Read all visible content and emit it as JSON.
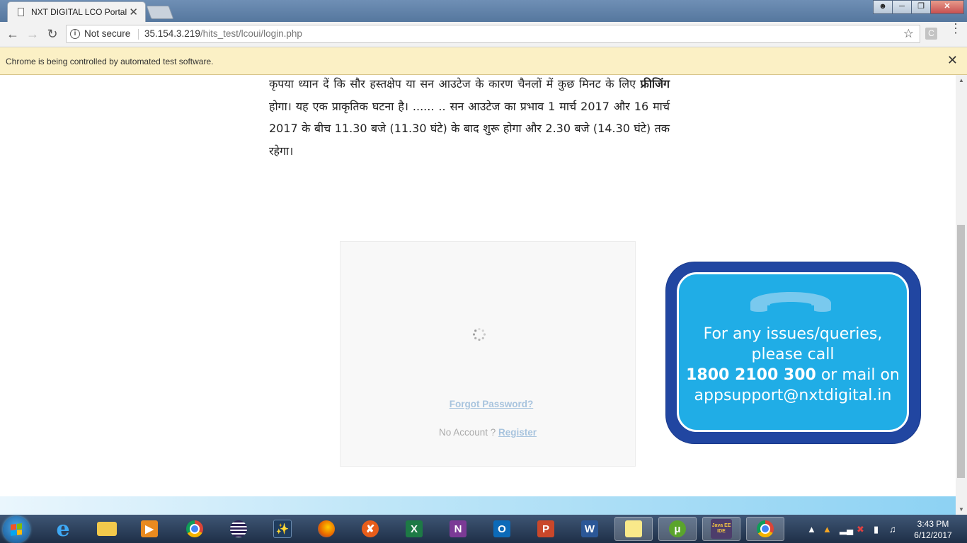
{
  "browser": {
    "tab_title": "NXT DIGITAL LCO Portal",
    "tab_close": "✕",
    "security_label": "Not secure",
    "url_host": "35.154.3.219",
    "url_path": "/hits_test/lcoui/login.php",
    "extension_letter": "C",
    "infobar_text": "Chrome is being controlled by automated test software.",
    "infobar_close": "✕"
  },
  "notice": {
    "text_before_bold": "कृपया ध्यान दें कि सौर हस्तक्षेप या सन आउटेज के कारण चैनलों में कुछ मिनट के लिए ",
    "bold": "फ्रीजिंग",
    "text_after_bold": "  होगा। यह एक प्राकृतिक घटना है। ...... .. सन आउटेज का प्रभाव 1 मार्च 2017 और 16 मार्च 2017 के बीच 11.30 बजे (11.30 घंटे) के बाद शुरू होगा और 2.30 बजे (14.30 घंटे) तक रहेगा।"
  },
  "login": {
    "forgot_password": "Forgot Password?",
    "no_account": "No Account ? ",
    "register": "Register"
  },
  "support_banner": {
    "line1": "For any issues/queries,",
    "line2": "please call",
    "phone": "1800 2100 300",
    "line3_suffix": " or mail on",
    "email": "appsupport@nxtdigital.in"
  },
  "taskbar": {
    "icons": [
      "start-button",
      "internet-explorer",
      "file-explorer",
      "media-player",
      "chrome",
      "eclipse",
      "mysql-workbench",
      "firefox",
      "tool",
      "excel",
      "onenote",
      "outlook",
      "powerpoint",
      "word",
      "sticky-notes",
      "utorrent",
      "java-ee-ide",
      "chrome-active"
    ],
    "labels": {
      "excel": "X",
      "onenote": "N",
      "outlook": "O",
      "powerpoint": "P",
      "word": "W",
      "java_ee": "Java EE IDE"
    },
    "time": "3:43 PM",
    "date": "6/12/2017"
  },
  "colors": {
    "infobar_bg": "#fbf0c5",
    "link_color": "#a8c4de",
    "banner_outer": "#2146a1",
    "banner_inner": "#20ade6"
  }
}
